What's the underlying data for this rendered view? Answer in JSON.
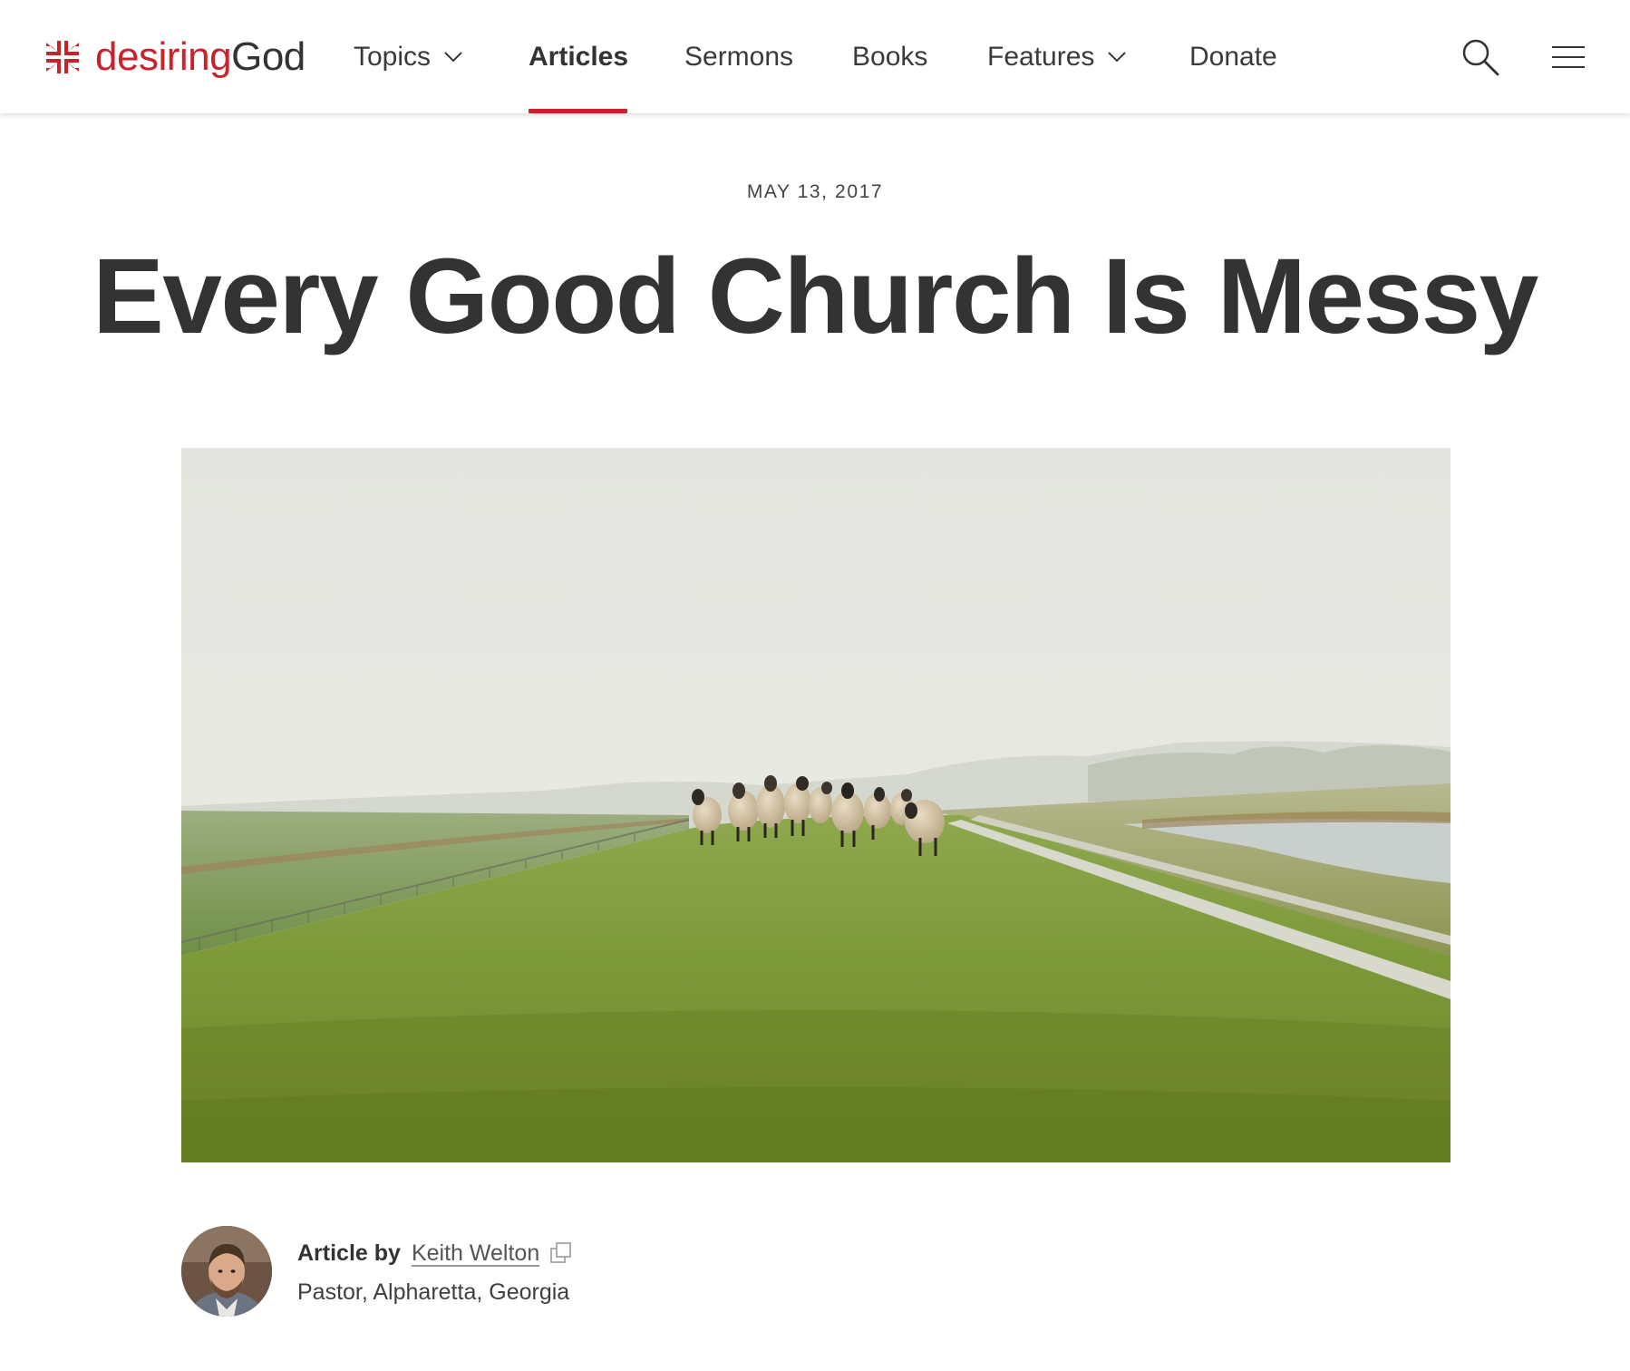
{
  "brand": {
    "name_part1": "desiring",
    "name_part2": "God",
    "accent_color": "#c8232c",
    "logo_icon": "cross-mark-icon"
  },
  "nav": {
    "items": [
      {
        "label": "Topics",
        "has_dropdown": true
      },
      {
        "label": "Articles",
        "active": true
      },
      {
        "label": "Sermons"
      },
      {
        "label": "Books"
      },
      {
        "label": "Features",
        "has_dropdown": true
      },
      {
        "label": "Donate"
      }
    ],
    "search_icon": "search-icon",
    "menu_icon": "hamburger-menu-icon"
  },
  "article": {
    "date": "MAY 13, 2017",
    "title": "Every Good Church Is Messy",
    "hero_image": "sheep-on-green-dike-photo"
  },
  "byline": {
    "prefix": "Article by",
    "author": "Keith Welton",
    "role": "Pastor, Alpharetta, Georgia",
    "author_icon": "copy-link-icon"
  }
}
